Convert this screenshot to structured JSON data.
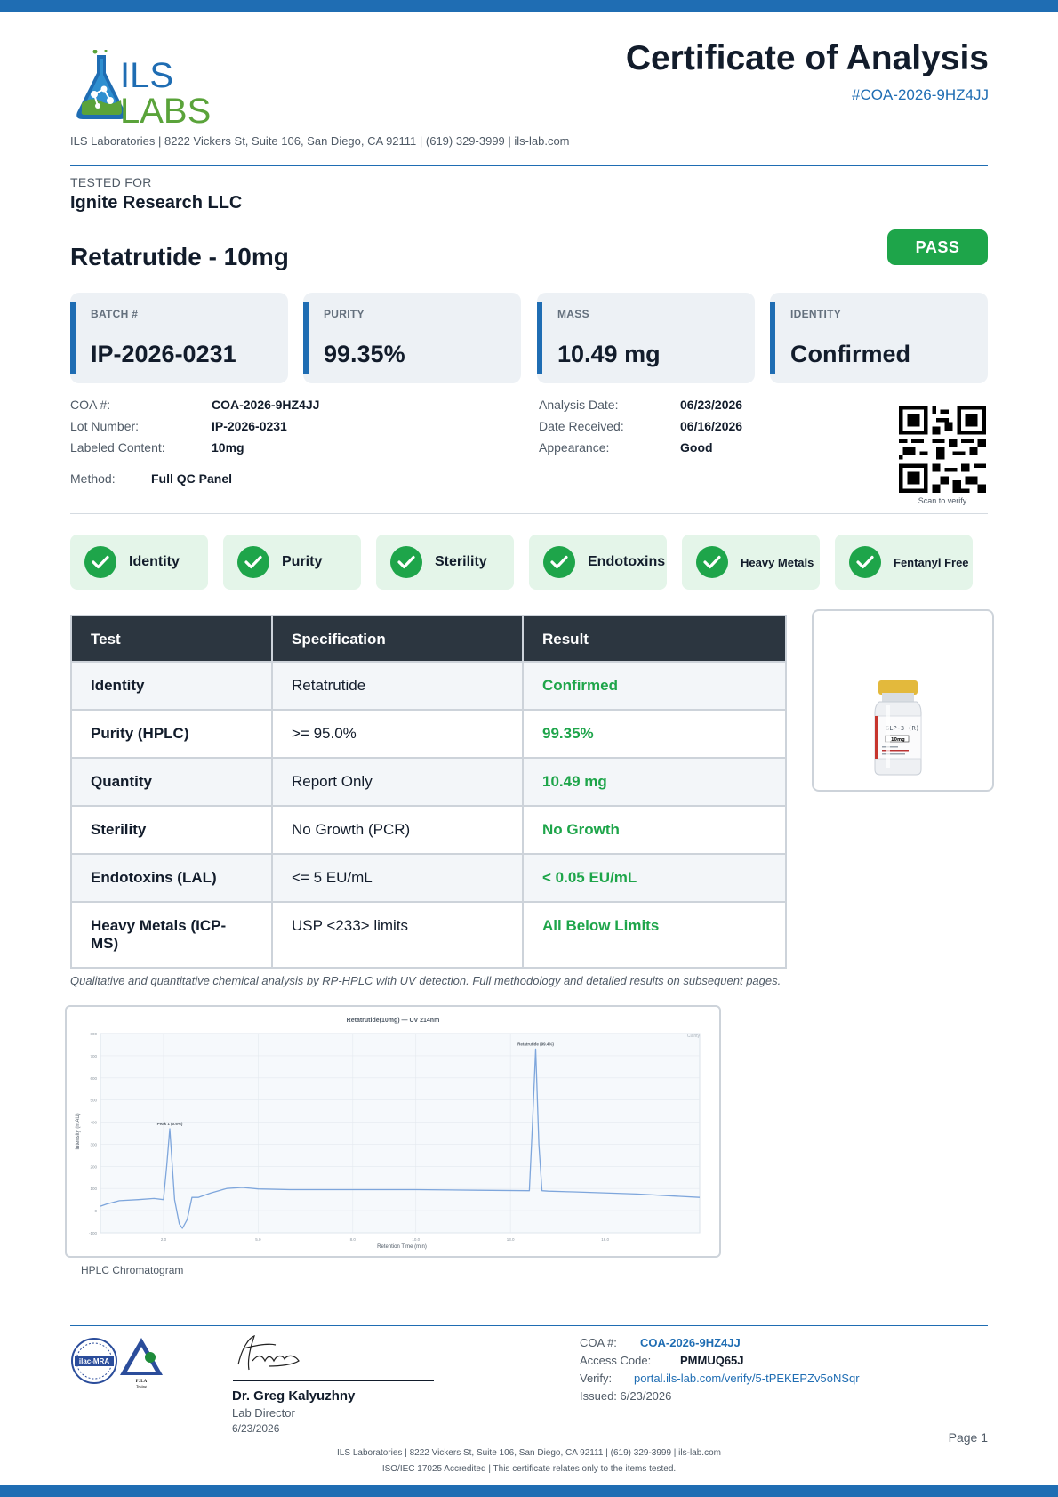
{
  "header": {
    "logo_text_top": "ILS",
    "logo_text_bottom": "LABS",
    "title": "Certificate of Analysis",
    "coa_number": "#COA-2026-9HZ4JJ",
    "lab_line": "ILS Laboratories  |  8222 Vickers St, Suite 106, San Diego, CA 92111  |  (619) 329-3999  |  ils-lab.com"
  },
  "client": {
    "label": "TESTED FOR",
    "name": "Ignite Research LLC"
  },
  "product": {
    "name": "Retatrutide - 10mg",
    "status": "PASS"
  },
  "stats": [
    {
      "label": "BATCH #",
      "value": "IP-2026-0231"
    },
    {
      "label": "PURITY",
      "value": "99.35%"
    },
    {
      "label": "MASS",
      "value": "10.49 mg"
    },
    {
      "label": "IDENTITY",
      "value": "Confirmed"
    }
  ],
  "details": {
    "coa_label": "COA #:",
    "coa_value": "COA-2026-9HZ4JJ",
    "lot_label": "Lot Number:",
    "lot_value": "IP-2026-0231",
    "labeled_label": "Labeled Content:",
    "labeled_value": "10mg",
    "method_label": "Method:",
    "method_value": "Full QC Panel",
    "analysis_label": "Analysis Date:",
    "analysis_value": "06/23/2026",
    "received_label": "Date Received:",
    "received_value": "06/16/2026",
    "appearance_label": "Appearance:",
    "appearance_value": "Good",
    "qr_caption": "Scan to verify"
  },
  "checks": [
    "Identity",
    "Purity",
    "Sterility",
    "Endotoxins",
    "Heavy Metals",
    "Fentanyl Free"
  ],
  "table": {
    "headers": [
      "Test",
      "Specification",
      "Result"
    ],
    "rows": [
      {
        "test": "Identity",
        "spec": "Retatrutide",
        "result": "Confirmed"
      },
      {
        "test": "Purity (HPLC)",
        "spec": ">= 95.0%",
        "result": "99.35%"
      },
      {
        "test": "Quantity",
        "spec": "Report Only",
        "result": "10.49 mg"
      },
      {
        "test": "Sterility",
        "spec": "No Growth (PCR)",
        "result": "No Growth"
      },
      {
        "test": "Endotoxins (LAL)",
        "spec": "<= 5 EU/mL",
        "result": "< 0.05 EU/mL"
      },
      {
        "test": "Heavy Metals (ICP-MS)",
        "spec": "USP <233> limits",
        "result": "All Below Limits"
      }
    ]
  },
  "vial": {
    "label": "GLP-3 (R)",
    "dose": "10mg"
  },
  "note": "Qualitative and quantitative chemical analysis by RP-HPLC with UV detection. Full methodology and detailed results on subsequent pages.",
  "chromatogram": {
    "caption": "HPLC Chromatogram",
    "title": "Retatrutide(10mg) — UV 214nm",
    "xlabel": "Retention Time (min)",
    "ylabel": "Intensity (mAU)",
    "legend": "Clarity",
    "peak1_label": "Peak 1 (0.6%)",
    "peak2_label": "Retatrutide (99.4%)"
  },
  "chart_data": {
    "type": "line",
    "title": "Retatrutide(10mg) — UV 214nm",
    "xlabel": "Retention Time (min)",
    "ylabel": "Intensity (mAU)",
    "xlim": [
      0,
      19
    ],
    "ylim": [
      -100,
      800
    ],
    "x_ticks": [
      2.0,
      5.0,
      8.0,
      10.0,
      13.0,
      16.0
    ],
    "y_ticks": [
      -100,
      0,
      100,
      200,
      300,
      400,
      500,
      600,
      700,
      800
    ],
    "series": [
      {
        "x": [
          0.0,
          0.2,
          0.6,
          1.2,
          1.7,
          2.0,
          2.1,
          2.2,
          2.35,
          2.5,
          2.6,
          2.75,
          2.9,
          3.1,
          3.5,
          4.0,
          4.5,
          5.0,
          6.0,
          8.0,
          10.0,
          12.0,
          13.6,
          13.7,
          13.8,
          13.9,
          14.0,
          14.2,
          15.0,
          17.0,
          19.0
        ],
        "y": [
          20,
          30,
          45,
          50,
          55,
          50,
          200,
          370,
          50,
          -60,
          -80,
          -40,
          60,
          60,
          80,
          100,
          105,
          98,
          95,
          95,
          95,
          92,
          90,
          400,
          730,
          300,
          90,
          88,
          85,
          75,
          60
        ]
      }
    ],
    "annotations": [
      {
        "label": "Peak 1 (0.6%)",
        "x": 2.2,
        "y": 370
      },
      {
        "label": "Retatrutide (99.4%)",
        "x": 13.8,
        "y": 730
      }
    ]
  },
  "footer": {
    "seal_text_1": "ilac-MRA",
    "seal_text_2": "PJLA",
    "seal_text_3": "Testing",
    "signer_name": "Dr. Greg Kalyuzhny",
    "signer_role": "Lab Director",
    "signer_date": "6/23/2026",
    "coa_label": "COA #:",
    "coa_value": "COA-2026-9HZ4JJ",
    "access_label": "Access Code:",
    "access_value": "PMMUQ65J",
    "verify_label": "Verify:",
    "verify_value": "portal.ils-lab.com/verify/5-tPEKEPZv5oNSqr",
    "issued": "Issued: 6/23/2026",
    "page": "Page 1",
    "line1": "ILS Laboratories  |  8222 Vickers St, Suite 106, San Diego, CA 92111  |  (619) 329-3999  |  ils-lab.com",
    "line2": "ISO/IEC 17025 Accredited  |  This certificate relates only to the items tested."
  },
  "colors": {
    "brand_blue": "#1f6db3",
    "pass_green": "#1ea54a",
    "logo_green": "#5aa33a",
    "table_header": "#2c3640"
  }
}
